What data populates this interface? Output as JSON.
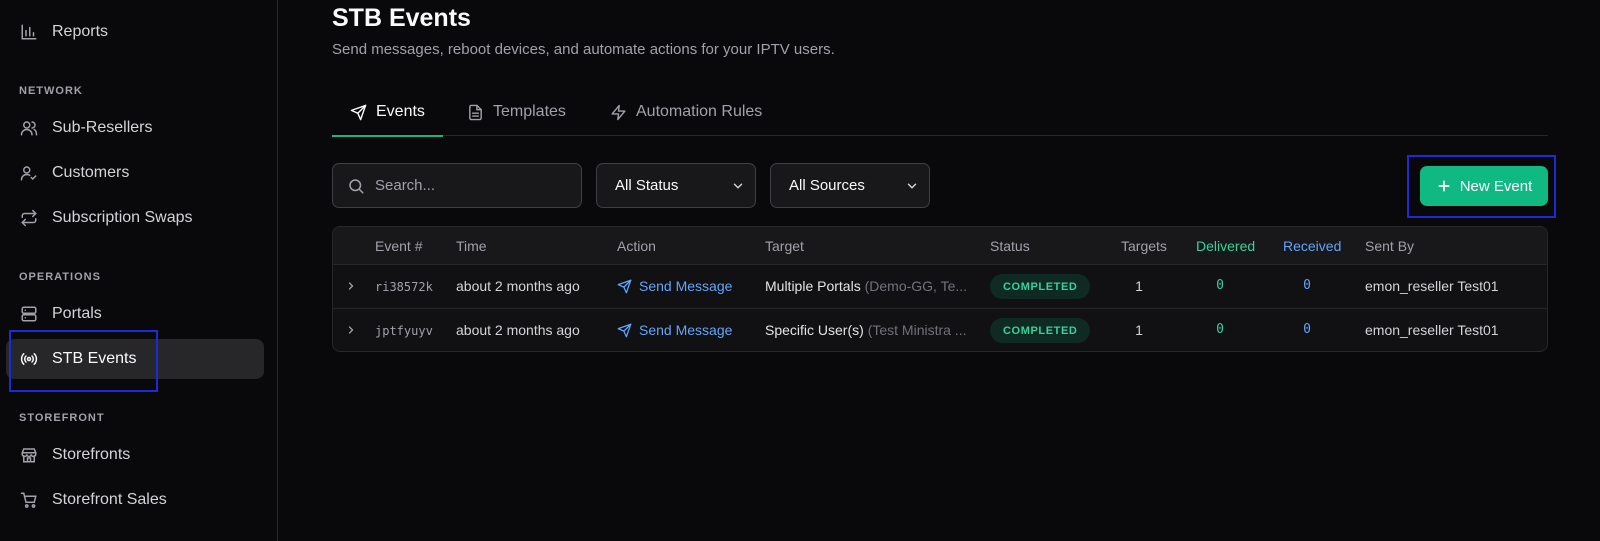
{
  "sidebar": {
    "top_items": [
      {
        "label": "Reports",
        "icon": "bar-chart-icon"
      }
    ],
    "sections": [
      {
        "label": "NETWORK",
        "items": [
          {
            "label": "Sub-Resellers",
            "icon": "users-icon"
          },
          {
            "label": "Customers",
            "icon": "user-check-icon"
          },
          {
            "label": "Subscription Swaps",
            "icon": "repeat-icon"
          }
        ]
      },
      {
        "label": "OPERATIONS",
        "items": [
          {
            "label": "Portals",
            "icon": "server-icon"
          },
          {
            "label": "STB Events",
            "icon": "broadcast-icon",
            "active": true
          }
        ]
      },
      {
        "label": "STOREFRONT",
        "items": [
          {
            "label": "Storefronts",
            "icon": "store-icon"
          },
          {
            "label": "Storefront Sales",
            "icon": "cart-icon"
          }
        ]
      }
    ]
  },
  "header": {
    "title": "STB Events",
    "subtitle": "Send messages, reboot devices, and automate actions for your IPTV users."
  },
  "tabs": [
    {
      "label": "Events",
      "icon": "send-icon",
      "active": true
    },
    {
      "label": "Templates",
      "icon": "file-text-icon"
    },
    {
      "label": "Automation Rules",
      "icon": "zap-icon"
    }
  ],
  "filters": {
    "search_placeholder": "Search...",
    "status_value": "All Status",
    "source_value": "All Sources"
  },
  "new_event_label": "New Event",
  "table": {
    "columns": [
      "Event #",
      "Time",
      "Action",
      "Target",
      "Status",
      "Targets",
      "Delivered",
      "Received",
      "Sent By"
    ],
    "rows": [
      {
        "event": "ri38572k",
        "time": "about 2 months ago",
        "action": "Send Message",
        "target": "Multiple Portals",
        "target_detail": "(Demo-GG, Te...",
        "status": "COMPLETED",
        "targets": "1",
        "delivered": "0",
        "received": "0",
        "sent_by": "emon_reseller Test01"
      },
      {
        "event": "jptfyuyv",
        "time": "about 2 months ago",
        "action": "Send Message",
        "target": "Specific User(s)",
        "target_detail": "(Test Ministra ...",
        "status": "COMPLETED",
        "targets": "1",
        "delivered": "0",
        "received": "0",
        "sent_by": "emon_reseller Test01"
      }
    ]
  },
  "colors": {
    "accent": "#10b981",
    "highlight": "#1d2bd6",
    "link": "#60a5fa",
    "background": "#09090b"
  }
}
